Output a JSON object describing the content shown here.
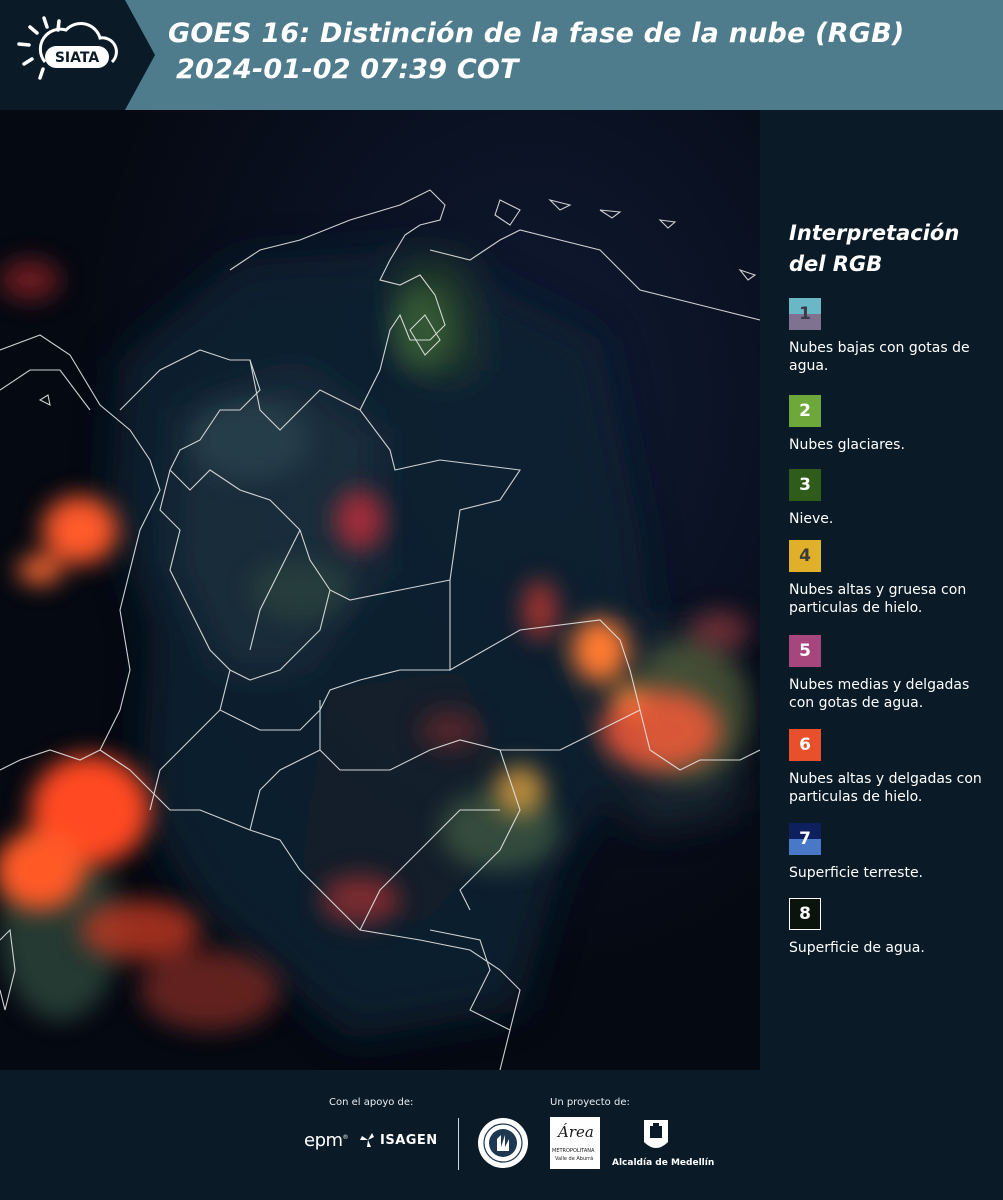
{
  "header": {
    "logo_text": "SIATA",
    "title_line1": "GOES 16: Distinción de la fase de la nube (RGB)",
    "title_line2": "2024-01-02 07:39 COT"
  },
  "legend": {
    "title_line1": "Interpretación",
    "title_line2": "del RGB",
    "items": [
      {
        "num": "1",
        "label": "Nubes bajas con gotas de agua.",
        "color_top": "#6ab7c6",
        "color_bottom": "#7f7290",
        "num_color": "#3a3a48"
      },
      {
        "num": "2",
        "label": "Nubes glaciares.",
        "color_top": "#6ea83a",
        "color_bottom": "#6ea83a",
        "num_color": "#ffffff"
      },
      {
        "num": "3",
        "label": "Nieve.",
        "color_top": "#2f5b1b",
        "color_bottom": "#2f5b1b",
        "num_color": "#ffffff"
      },
      {
        "num": "4",
        "label": "Nubes altas y gruesa con particulas de hielo.",
        "color_top": "#e0b02a",
        "color_bottom": "#e0b02a",
        "num_color": "#3a3a3a"
      },
      {
        "num": "5",
        "label": "Nubes medias y delgadas con gotas de agua.",
        "color_top": "#a7467c",
        "color_bottom": "#a7467c",
        "num_color": "#ffffff"
      },
      {
        "num": "6",
        "label": "Nubes altas y delgadas con particulas de hielo.",
        "color_top": "#e7502a",
        "color_bottom": "#e7502a",
        "num_color": "#ffffff"
      },
      {
        "num": "7",
        "label": "Superficie terreste.",
        "color_top": "#0e1f5e",
        "color_bottom": "#4a78c9",
        "num_color": "#ffffff"
      },
      {
        "num": "8",
        "label": "Superficie de agua.",
        "color_top": "#0a140c",
        "color_bottom": "#0a140c",
        "num_color": "#ffffff"
      }
    ]
  },
  "footer": {
    "support_label": "Con el apoyo de:",
    "project_label": "Un proyecto de:",
    "sponsor_epm": "epm",
    "sponsor_isagen": "ISAGEN",
    "partner_area_title": "Área",
    "partner_area_sub1": "METROPOLITANA",
    "partner_area_sub2": "Valle de Aburrá",
    "partner_alcaldia": "Alcaldía de Medellín"
  },
  "colors": {
    "header_bg": "#4f7c8c",
    "panel_bg": "#0a1b27",
    "map_bg": "#060a12"
  }
}
